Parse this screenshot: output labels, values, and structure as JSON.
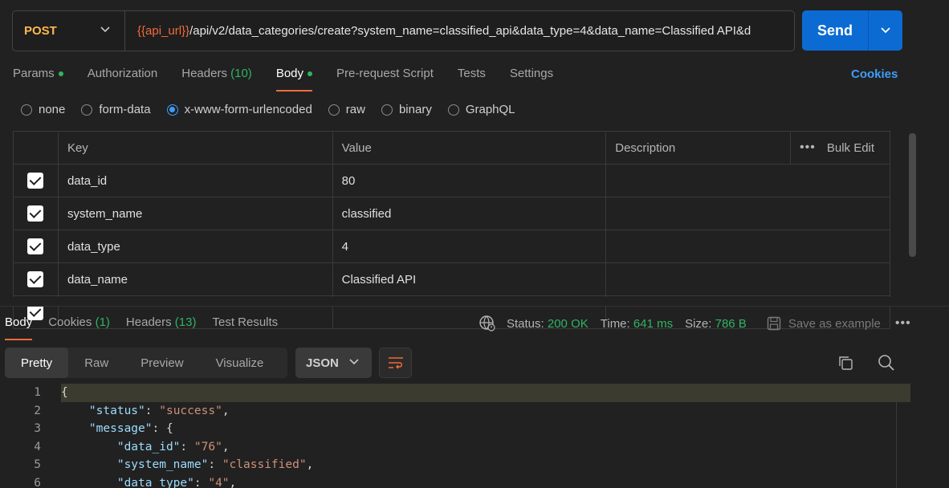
{
  "request": {
    "method": "POST",
    "url_var": "{{api_url}}",
    "url_rest": "/api/v2/data_categories/create?system_name=classified_api&data_type=4&data_name=Classified API&d",
    "send_label": "Send"
  },
  "req_tabs": [
    {
      "label": "Params",
      "count": "",
      "dot": true
    },
    {
      "label": "Authorization",
      "count": "",
      "dot": false
    },
    {
      "label": "Headers",
      "count": "(10)",
      "dot": false
    },
    {
      "label": "Body",
      "count": "",
      "dot": true,
      "active": true
    },
    {
      "label": "Pre-request Script",
      "count": "",
      "dot": false
    },
    {
      "label": "Tests",
      "count": "",
      "dot": false
    },
    {
      "label": "Settings",
      "count": "",
      "dot": false
    }
  ],
  "cookies_label": "Cookies",
  "body_types": [
    "none",
    "form-data",
    "x-www-form-urlencoded",
    "raw",
    "binary",
    "GraphQL"
  ],
  "body_type_selected": "x-www-form-urlencoded",
  "table": {
    "headers": {
      "key": "Key",
      "value": "Value",
      "description": "Description",
      "bulk_edit": "Bulk Edit"
    },
    "rows": [
      {
        "key": "data_id",
        "value": "80",
        "description": ""
      },
      {
        "key": "system_name",
        "value": "classified",
        "description": ""
      },
      {
        "key": "data_type",
        "value": "4",
        "description": ""
      },
      {
        "key": "data_name",
        "value": "Classified API",
        "description": ""
      }
    ]
  },
  "resp_tabs": [
    {
      "label": "Body",
      "count": "",
      "active": true
    },
    {
      "label": "Cookies",
      "count": "(1)"
    },
    {
      "label": "Headers",
      "count": "(13)"
    },
    {
      "label": "Test Results",
      "count": ""
    }
  ],
  "resp_meta": {
    "status_label": "Status:",
    "status_value": "200 OK",
    "time_label": "Time:",
    "time_value": "641 ms",
    "size_label": "Size:",
    "size_value": "786 B",
    "save_label": "Save as example"
  },
  "view_tabs": [
    "Pretty",
    "Raw",
    "Preview",
    "Visualize"
  ],
  "format": "JSON",
  "code_lines": [
    {
      "n": "1",
      "indent": "",
      "key": "",
      "value": "",
      "text": "{"
    },
    {
      "n": "2",
      "indent": "    ",
      "key": "\"status\"",
      "value": "\"success\"",
      "text": ","
    },
    {
      "n": "3",
      "indent": "    ",
      "key": "\"message\"",
      "value": "",
      "text": "{"
    },
    {
      "n": "4",
      "indent": "        ",
      "key": "\"data_id\"",
      "value": "\"76\"",
      "text": ","
    },
    {
      "n": "5",
      "indent": "        ",
      "key": "\"system_name\"",
      "value": "\"classified\"",
      "text": ","
    },
    {
      "n": "6",
      "indent": "        ",
      "key": "\"data_type\"",
      "value": "\"4\"",
      "text": ","
    }
  ],
  "colors": {
    "accent": "#f26b3a",
    "send": "#0c6bd3",
    "success": "#2fb463",
    "link": "#3d9df6",
    "method": "#ffb84d"
  }
}
